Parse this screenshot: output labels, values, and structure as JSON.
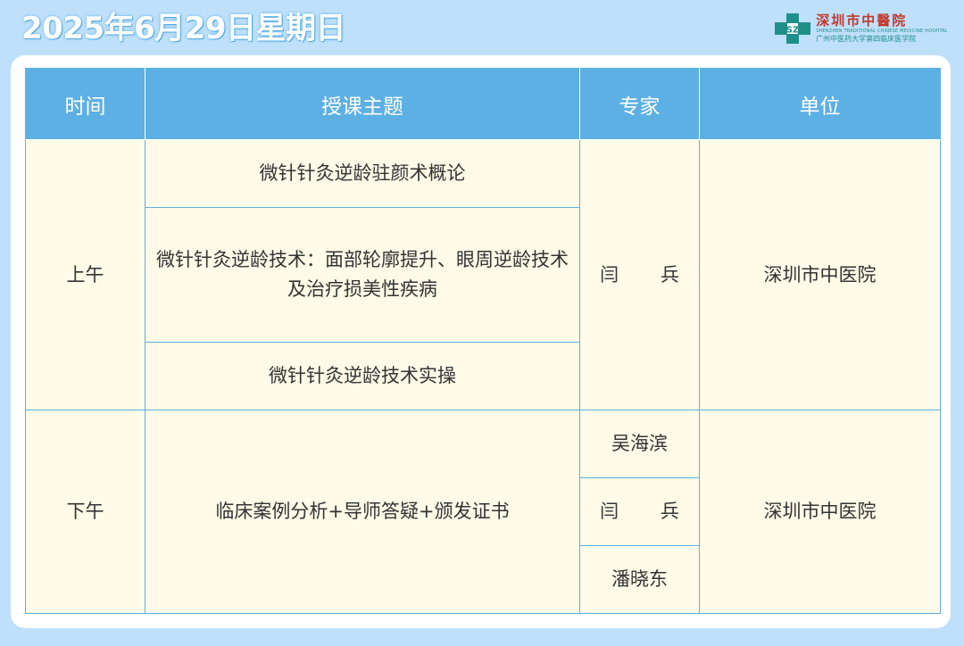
{
  "header": {
    "date": "2025年6月29日星期日"
  },
  "logo": {
    "name": "深圳市中醫院",
    "english": "SHENZHEN TRADITIONAL CHINESE MEDICINE HOSPITAL",
    "subtitle": "广州中医药大学第四临床医学院",
    "mark_letters": "SZ",
    "colors": {
      "mark": "#1f8f8a",
      "name": "#c0392b"
    }
  },
  "table": {
    "headers": [
      "时间",
      "授课主题",
      "专家",
      "单位"
    ],
    "morning": {
      "time": "上午",
      "topics": [
        "微针针灸逆龄驻颜术概论",
        "微针针灸逆龄技术：面部轮廓提升、眼周逆龄技术及治疗损美性疾病",
        "微针针灸逆龄技术实操"
      ],
      "expert": "闫 兵",
      "unit": "深圳市中医院"
    },
    "afternoon": {
      "time": "下午",
      "topic": "临床案例分析+导师答疑+颁发证书",
      "experts": [
        "吴海滨",
        "闫 兵",
        "潘晓东"
      ],
      "unit": "深圳市中医院"
    }
  },
  "colors": {
    "background": "#bfe0fb",
    "header_fill": "#5db0e4",
    "cell_fill": "#fffbe8",
    "border": "#5db0e4"
  }
}
